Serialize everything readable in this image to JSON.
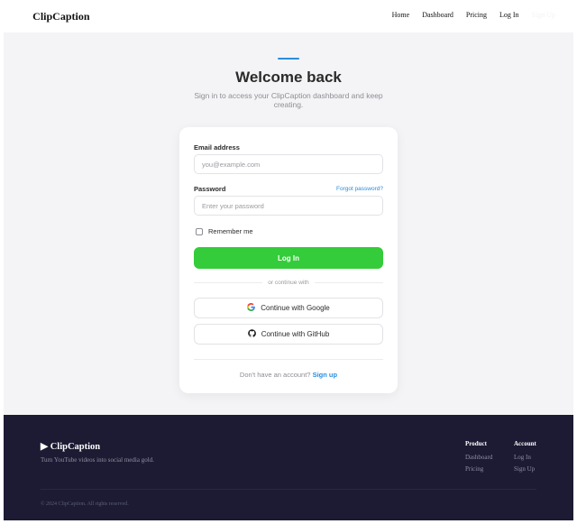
{
  "header": {
    "brand_icon": "play-icon",
    "brand_name": "ClipCaption",
    "nav": [
      "Home",
      "Dashboard",
      "Pricing",
      "Log In"
    ],
    "signup_label": "Sign Up"
  },
  "main": {
    "title": "Welcome back",
    "subtitle": "Sign in to access your ClipCaption dashboard and keep creating.",
    "accent_color": "#2a8ddb"
  },
  "form": {
    "email_label": "Email address",
    "email_placeholder": "you@example.com",
    "email_value": "",
    "password_label": "Password",
    "forgot_label": "Forgot password?",
    "password_placeholder": "Enter your password",
    "password_value": "",
    "remember_label": "Remember me",
    "remember_checked": false,
    "login_label": "Log In",
    "login_color": "#34cc3a",
    "divider_text": "or continue with",
    "google_label": "Continue with Google",
    "github_label": "Continue with GitHub",
    "no_account_text": "Don't have an account?",
    "signup_link": "Sign up"
  },
  "footer": {
    "brand": "▶ ClipCaption",
    "tagline": "Turn YouTube videos into social media gold.",
    "product_heading": "Product",
    "product_links": [
      "Dashboard",
      "Pricing"
    ],
    "account_heading": "Account",
    "account_links": [
      "Log In",
      "Sign Up"
    ],
    "copyright": "© 2024 ClipCaption. All rights reserved.",
    "background": "#1c1b33"
  }
}
